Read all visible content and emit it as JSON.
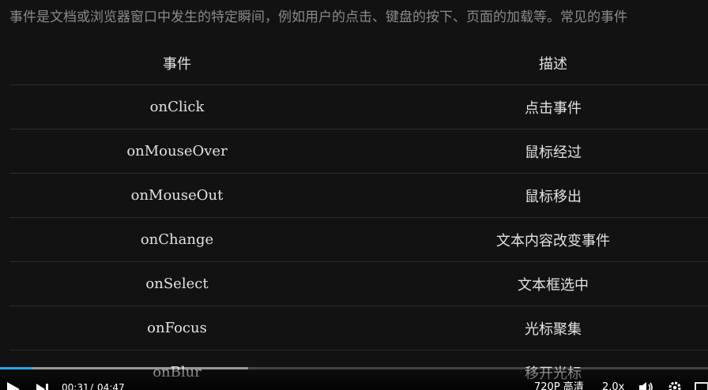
{
  "intro_text": "事件是文档或浏览器窗口中发生的特定瞬间，例如用户的点击、键盘的按下、页面的加载等。常见的事件",
  "table": {
    "headers": [
      "事件",
      "描述"
    ],
    "rows": [
      {
        "event": "onClick",
        "desc": "点击事件"
      },
      {
        "event": "onMouseOver",
        "desc": "鼠标经过"
      },
      {
        "event": "onMouseOut",
        "desc": "鼠标移出"
      },
      {
        "event": "onChange",
        "desc": "文本内容改变事件"
      },
      {
        "event": "onSelect",
        "desc": "文本框选中"
      },
      {
        "event": "onFocus",
        "desc": "光标聚集"
      },
      {
        "event": "onBlur",
        "desc": "移开光标"
      }
    ]
  },
  "player": {
    "current_time": "00:31",
    "separator": "/",
    "duration": "04:47",
    "quality": "720P 高清",
    "speed": "2.0x",
    "played_fraction": 0.045,
    "buffered_fraction": 0.35,
    "accent_color": "#2aa3ef",
    "icons": [
      "play-icon",
      "next-icon",
      "volume-icon",
      "settings-icon",
      "fullscreen-icon"
    ]
  }
}
